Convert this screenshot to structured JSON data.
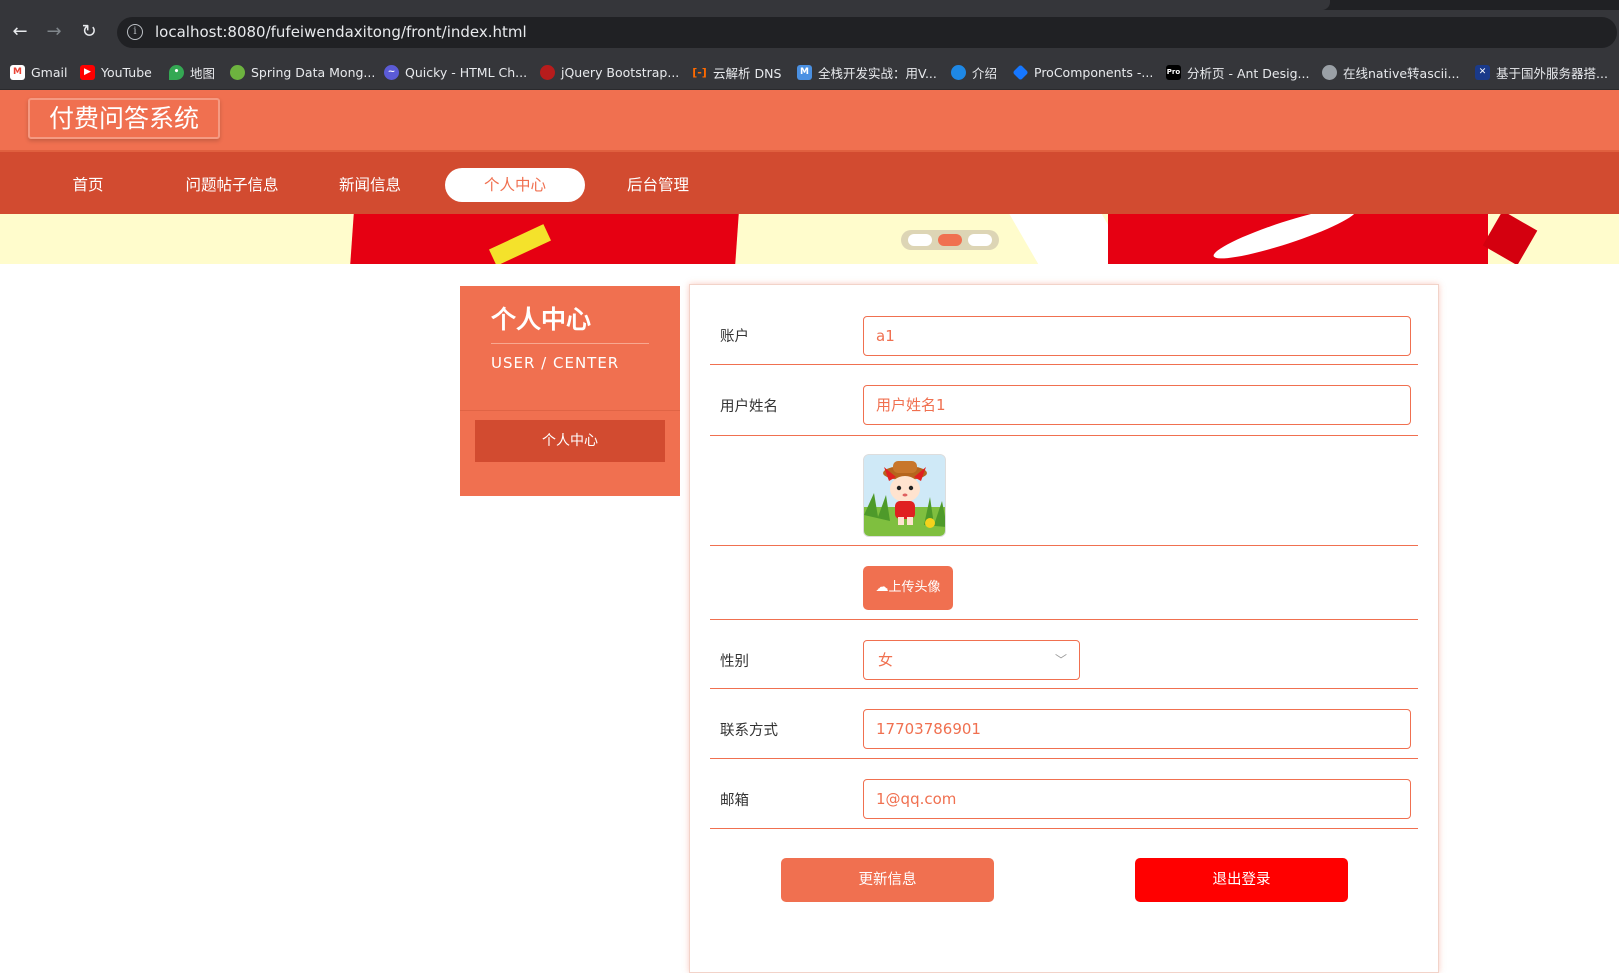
{
  "browser": {
    "url_host": "localhost",
    "url_rest": ":8080/fufeiwendaxitong/front/index.html",
    "bookmarks": [
      {
        "label": "Gmail",
        "icon": "gmail-icon",
        "color": "#ea4335",
        "glyph": "M"
      },
      {
        "label": "YouTube",
        "icon": "youtube-icon",
        "color": "#ff0000",
        "glyph": "▶"
      },
      {
        "label": "地图",
        "icon": "maps-icon",
        "color": "#34a853",
        "glyph": "◆"
      },
      {
        "label": "Spring Data Mong...",
        "icon": "spring-icon",
        "color": "#6db33f",
        "glyph": "●"
      },
      {
        "label": "Quicky - HTML Ch...",
        "icon": "quicky-icon",
        "color": "#5b5bd6",
        "glyph": "Q"
      },
      {
        "label": "jQuery Bootstrap...",
        "icon": "jquery-icon",
        "color": "#c0392b",
        "glyph": "●"
      },
      {
        "label": "云解析 DNS",
        "icon": "aliyun-icon",
        "color": "#ff6a00",
        "glyph": "[-]"
      },
      {
        "label": "全栈开发实战：用V...",
        "icon": "m-icon",
        "color": "#4a90e2",
        "glyph": "M"
      },
      {
        "label": "介绍",
        "icon": "globe-icon",
        "color": "#1e88e5",
        "glyph": "●"
      },
      {
        "label": "ProComponents -...",
        "icon": "antd-icon",
        "color": "#1677ff",
        "glyph": "◆"
      },
      {
        "label": "分析页 - Ant Desig...",
        "icon": "pro-icon",
        "color": "#000000",
        "glyph": "Pro"
      },
      {
        "label": "在线native转ascii...",
        "icon": "web-icon",
        "color": "#9aa0a6",
        "glyph": "●"
      },
      {
        "label": "基于国外服务器搭...",
        "icon": "flag-icon",
        "color": "#1a3a8a",
        "glyph": "✕"
      }
    ]
  },
  "site": {
    "logo": "付费问答系统",
    "nav": [
      "首页",
      "问题帖子信息",
      "新闻信息",
      "个人中心",
      "后台管理"
    ],
    "active_nav": "个人中心"
  },
  "sidebar": {
    "title": "个人中心",
    "subtitle": "USER / CENTER",
    "button": "个人中心"
  },
  "form": {
    "account_label": "账户",
    "account_value": "a1",
    "name_label": "用户姓名",
    "name_value": "用户姓名1",
    "upload_label": "上传头像",
    "gender_label": "性别",
    "gender_value": "女",
    "phone_label": "联系方式",
    "phone_value": "17703786901",
    "email_label": "邮箱",
    "email_value": "1@qq.com",
    "update_button": "更新信息",
    "logout_button": "退出登录"
  },
  "colors": {
    "primary": "#f07050",
    "nav_bg": "#d24b30",
    "logout": "#ff0000"
  }
}
